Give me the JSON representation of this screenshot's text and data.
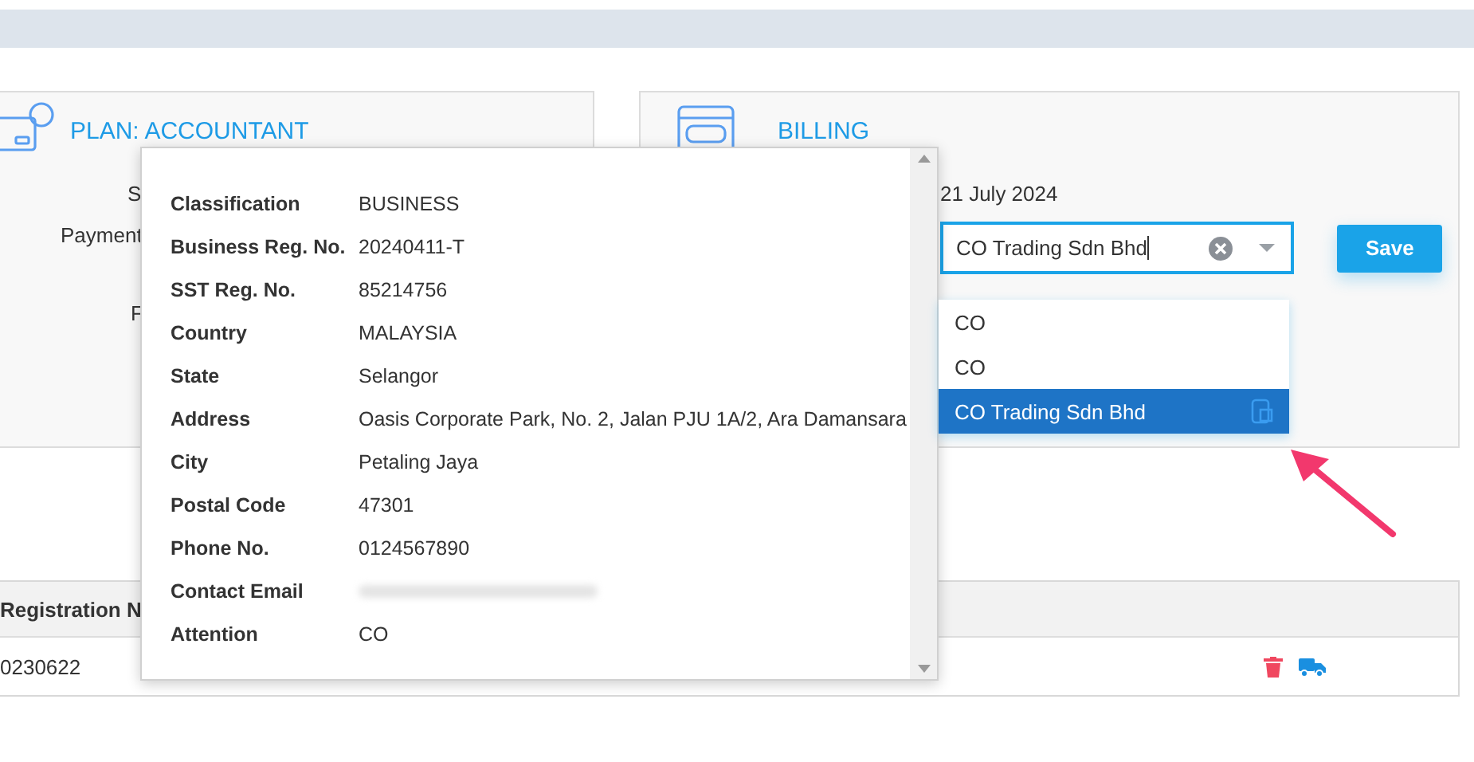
{
  "plan_card": {
    "title": "PLAN: ACCOUNTANT",
    "labels": [
      "S",
      "Payment",
      "F"
    ]
  },
  "billing_card": {
    "title": "BILLING",
    "date": "21 July 2024",
    "company_field": {
      "value": "CO Trading Sdn Bhd"
    },
    "options": [
      {
        "label": "CO",
        "selected": false
      },
      {
        "label": "CO",
        "selected": false
      },
      {
        "label": "CO Trading Sdn Bhd",
        "selected": true
      }
    ],
    "save_button": "Save"
  },
  "details_popup": {
    "rows": [
      {
        "label": "Classification",
        "value": "BUSINESS"
      },
      {
        "label": "Business Reg. No.",
        "value": "20240411-T"
      },
      {
        "label": "SST Reg. No.",
        "value": "85214756"
      },
      {
        "label": "Country",
        "value": "MALAYSIA"
      },
      {
        "label": "State",
        "value": "Selangor"
      },
      {
        "label": "Address",
        "value": "Oasis Corporate Park, No. 2, Jalan PJU 1A/2, Ara Damansara"
      },
      {
        "label": "City",
        "value": "Petaling Jaya"
      },
      {
        "label": "Postal Code",
        "value": "47301"
      },
      {
        "label": "Phone No.",
        "value": "0124567890"
      },
      {
        "label": "Contact Email",
        "blurred": true
      },
      {
        "label": "Attention",
        "value": "CO"
      }
    ]
  },
  "table": {
    "columns": [
      "Registration N"
    ],
    "rows": [
      {
        "cells": [
          "0230622"
        ]
      }
    ]
  }
}
